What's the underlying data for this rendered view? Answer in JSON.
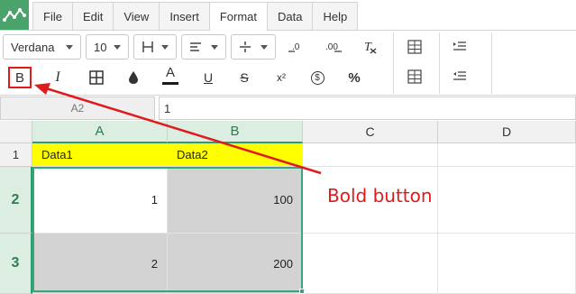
{
  "menu": {
    "tabs": [
      {
        "label": "File"
      },
      {
        "label": "Edit"
      },
      {
        "label": "View"
      },
      {
        "label": "Insert"
      },
      {
        "label": "Format"
      },
      {
        "label": "Data"
      },
      {
        "label": "Help"
      }
    ],
    "active_tab": "Format"
  },
  "toolbar": {
    "font_family": "Verdana",
    "font_size": "10",
    "bold_label": "B",
    "italic_label": "I",
    "text_color_label": "A",
    "underline_label": "U",
    "strikethrough_label": "S",
    "superscript_label": "x²",
    "currency_label": "$",
    "percent_label": "%",
    "text_color": "#1a1a1a"
  },
  "formula_bar": {
    "cell_ref": "A2",
    "value": "1"
  },
  "grid": {
    "columns": [
      "A",
      "B",
      "C",
      "D"
    ],
    "rows": [
      "1",
      "2",
      "3"
    ],
    "cells": {
      "A1": "Data1",
      "B1": "Data2",
      "A2": "1",
      "B2": "100",
      "A3": "2",
      "B3": "200"
    },
    "colors": {
      "header_fill": "#ffff00",
      "data_fill": "#d3d3d3",
      "selection_border": "#3aa57a"
    }
  },
  "annotation": {
    "text": "Bold button",
    "color": "#e01b1b"
  }
}
